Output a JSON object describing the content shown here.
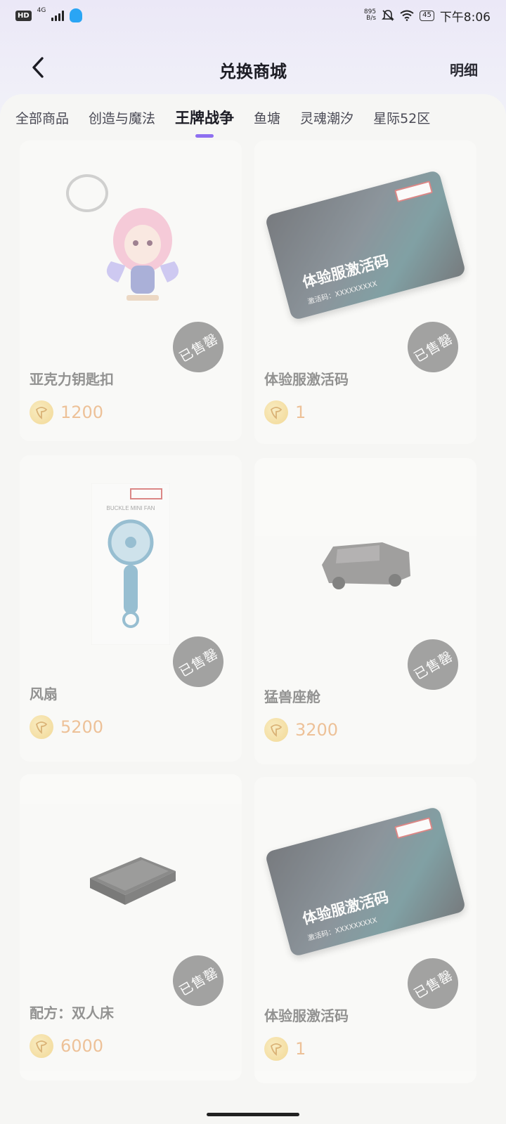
{
  "status_bar": {
    "hd": "HD",
    "network": "4G",
    "speed_value": "895",
    "speed_unit": "B/s",
    "battery": "45",
    "time": "下午8:06"
  },
  "header": {
    "title": "兑换商城",
    "detail_label": "明细"
  },
  "tabs": [
    {
      "label": "全部商品",
      "active": false
    },
    {
      "label": "创造与魔法",
      "active": false
    },
    {
      "label": "王牌战争",
      "active": true
    },
    {
      "label": "鱼塘",
      "active": false
    },
    {
      "label": "灵魂潮汐",
      "active": false
    },
    {
      "label": "星际52区",
      "active": false
    }
  ],
  "products": [
    {
      "name": "亚克力钥匙扣",
      "price": "1200",
      "status": "已售罄",
      "image": "acrylic-keychain"
    },
    {
      "name": "体验服激活码",
      "price": "1",
      "status": "已售罄",
      "image": "activation-card"
    },
    {
      "name": "风扇",
      "price": "5200",
      "status": "已售罄",
      "image": "mini-fan"
    },
    {
      "name": "猛兽座舱",
      "price": "3200",
      "status": "已售罄",
      "image": "vehicle-cockpit"
    },
    {
      "name": "配方：双人床",
      "price": "6000",
      "status": "已售罄",
      "image": "double-bed"
    },
    {
      "name": "体验服激活码",
      "price": "1",
      "status": "已售罄",
      "image": "activation-card"
    }
  ],
  "activation_card_art": {
    "title": "体验服激活码",
    "subtitle": "激活码：XXXXXXXXX"
  },
  "fan_art": {
    "model": "BUCKLE MINI FAN"
  },
  "colors": {
    "accent": "#8e6ff0",
    "price": "#e9a260",
    "sold_badge": "#6f6f6f"
  }
}
